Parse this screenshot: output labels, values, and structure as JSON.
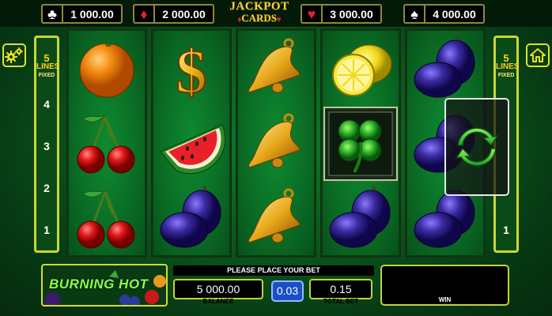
{
  "jackpots": [
    {
      "suit": "clubs",
      "symbol": "♣",
      "value": "1 000.00",
      "color": "#ffffff"
    },
    {
      "suit": "diamonds",
      "symbol": "♦",
      "value": "2 000.00",
      "color": "#e0222a"
    },
    {
      "suit": "hearts",
      "symbol": "♥",
      "value": "3 000.00",
      "color": "#e0222a"
    },
    {
      "suit": "spades",
      "symbol": "♠",
      "value": "4 000.00",
      "color": "#ffffff"
    }
  ],
  "jackpot_logo": {
    "line1": "JACKPOT",
    "line2": "CARDS"
  },
  "lines_panel": {
    "count": "5",
    "word": "LINES",
    "mode": "FIXED",
    "numbers": [
      "4",
      "3",
      "2",
      "1"
    ]
  },
  "reels": [
    [
      "orange",
      "cherries",
      "cherries"
    ],
    [
      "dollar",
      "watermelon",
      "plums"
    ],
    [
      "bell",
      "bell",
      "bell"
    ],
    [
      "lemon",
      "clover",
      "plums"
    ],
    [
      "plums",
      "plums",
      "plums"
    ]
  ],
  "bottom": {
    "game_logo": "BURNING HOT",
    "message": "PLEASE PLACE YOUR BET",
    "balance_value": "5 000.00",
    "balance_label": "BALANCE",
    "bet_per_line": "0.03",
    "total_bet_value": "0.15",
    "total_bet_label": "TOTAL BET",
    "win_label": "WIN"
  },
  "icons": {
    "settings": "gears-icon",
    "home": "home-icon",
    "spin": "refresh-spin-icon"
  },
  "colors": {
    "accent_border": "#c9d636",
    "bet_button": "#1750c8",
    "jackpot_gold": "#f5d23a"
  }
}
